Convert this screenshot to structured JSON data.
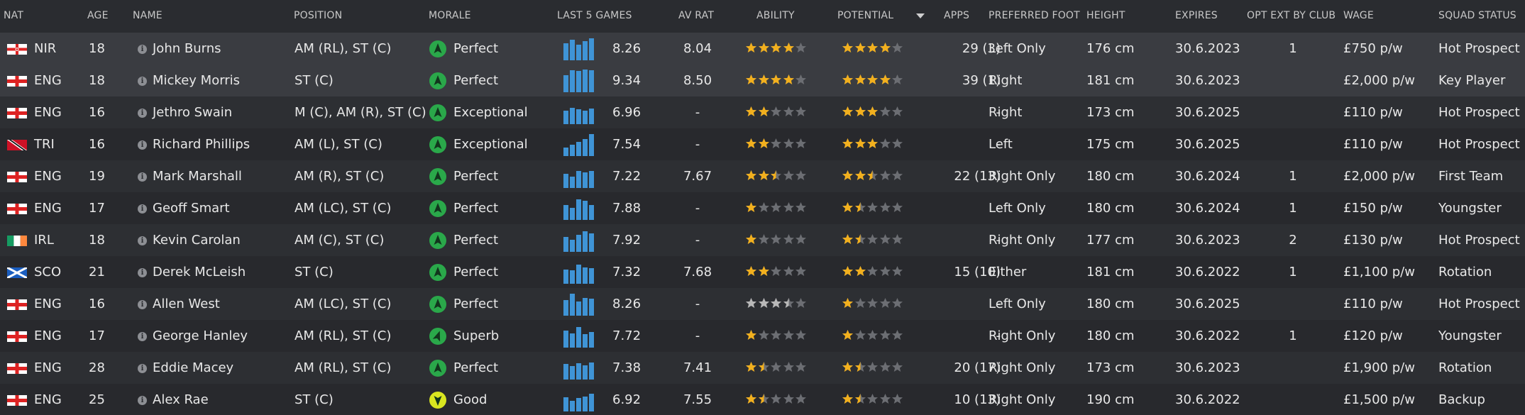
{
  "header": {
    "nat": "NAT",
    "age": "AGE",
    "name": "NAME",
    "position": "POSITION",
    "morale": "MORALE",
    "last5": "LAST 5 GAMES",
    "avrat": "AV RAT",
    "ability": "ABILITY",
    "potential": "POTENTIAL",
    "apps": "APPS",
    "foot": "PREFERRED FOOT",
    "height": "HEIGHT",
    "expires": "EXPIRES",
    "optext": "OPT EXT BY CLUB",
    "wage": "WAGE",
    "status": "SQUAD STATUS"
  },
  "colors": {
    "bar": "#3f94d6",
    "star_gold": "#f2b01e",
    "star_silver": "#b8b8b8",
    "star_empty": "#6c6e73",
    "morale_green": "#2aa84a",
    "morale_yellow": "#d9e620"
  },
  "rows": [
    {
      "nat": "NIR",
      "flag": "nir",
      "age": "18",
      "name": "John Burns",
      "position": "AM (RL), ST (C)",
      "morale": "Perfect",
      "morale_level": "perfect",
      "last5": [
        0.72,
        0.86,
        0.66,
        0.8,
        0.92
      ],
      "form": "8.26",
      "avrat": "8.04",
      "ability": 4.0,
      "ability_style": "gold",
      "potential": 4.0,
      "apps": "29 (3)",
      "foot": "Left Only",
      "height": "176 cm",
      "expires": "30.6.2023",
      "optext": "1",
      "wage": "£750 p/w",
      "status": "Hot Prospect"
    },
    {
      "nat": "ENG",
      "flag": "eng",
      "age": "18",
      "name": "Mickey Morris",
      "position": "ST (C)",
      "morale": "Perfect",
      "morale_level": "perfect",
      "last5": [
        0.72,
        0.92,
        0.88,
        0.95,
        0.9
      ],
      "form": "9.34",
      "avrat": "8.50",
      "ability": 4.0,
      "ability_style": "gold",
      "potential": 4.0,
      "apps": "39 (1)",
      "foot": "Right",
      "height": "181 cm",
      "expires": "30.6.2023",
      "optext": "",
      "wage": "£2,000 p/w",
      "status": "Key Player"
    },
    {
      "nat": "ENG",
      "flag": "eng",
      "age": "16",
      "name": "Jethro Swain",
      "position": "M (C), AM (R), ST (C)",
      "morale": "Exceptional",
      "morale_level": "exceptional",
      "last5": [
        0.55,
        0.68,
        0.62,
        0.55,
        0.64
      ],
      "form": "6.96",
      "avrat": "-",
      "ability": 2.0,
      "ability_style": "gold",
      "potential": 3.0,
      "apps": "-",
      "foot": "Right",
      "height": "173 cm",
      "expires": "30.6.2025",
      "optext": "",
      "wage": "£110 p/w",
      "status": "Hot Prospect"
    },
    {
      "nat": "TRI",
      "flag": "tri",
      "age": "16",
      "name": "Richard Phillips",
      "position": "AM (L), ST (C)",
      "morale": "Exceptional",
      "morale_level": "exceptional",
      "last5": [
        0.35,
        0.48,
        0.58,
        0.72,
        0.9
      ],
      "form": "7.54",
      "avrat": "-",
      "ability": 2.0,
      "ability_style": "gold",
      "potential": 3.0,
      "apps": "-",
      "foot": "Left",
      "height": "175 cm",
      "expires": "30.6.2025",
      "optext": "",
      "wage": "£110 p/w",
      "status": "Hot Prospect"
    },
    {
      "nat": "ENG",
      "flag": "eng",
      "age": "19",
      "name": "Mark Marshall",
      "position": "AM (R), ST (C)",
      "morale": "Perfect",
      "morale_level": "perfect",
      "last5": [
        0.6,
        0.48,
        0.72,
        0.64,
        0.72
      ],
      "form": "7.22",
      "avrat": "7.67",
      "ability": 2.5,
      "ability_style": "gold",
      "potential": 2.5,
      "apps": "22 (13)",
      "foot": "Right Only",
      "height": "180 cm",
      "expires": "30.6.2024",
      "optext": "1",
      "wage": "£2,000 p/w",
      "status": "First Team"
    },
    {
      "nat": "ENG",
      "flag": "eng",
      "age": "17",
      "name": "Geoff Smart",
      "position": "AM (LC), ST (C)",
      "morale": "Perfect",
      "morale_level": "perfect",
      "last5": [
        0.62,
        0.5,
        0.85,
        0.78,
        0.62
      ],
      "form": "7.88",
      "avrat": "-",
      "ability": 1.0,
      "ability_style": "gold",
      "potential": 1.5,
      "apps": "-",
      "foot": "Left Only",
      "height": "180 cm",
      "expires": "30.6.2024",
      "optext": "1",
      "wage": "£150 p/w",
      "status": "Youngster"
    },
    {
      "nat": "IRL",
      "flag": "irl",
      "age": "18",
      "name": "Kevin Carolan",
      "position": "AM (C), ST (C)",
      "morale": "Perfect",
      "morale_level": "perfect",
      "last5": [
        0.62,
        0.5,
        0.72,
        0.85,
        0.76
      ],
      "form": "7.92",
      "avrat": "-",
      "ability": 1.0,
      "ability_style": "gold",
      "potential": 1.5,
      "apps": "-",
      "foot": "Right Only",
      "height": "177 cm",
      "expires": "30.6.2023",
      "optext": "2",
      "wage": "£130 p/w",
      "status": "Hot Prospect"
    },
    {
      "nat": "SCO",
      "flag": "sco",
      "age": "21",
      "name": "Derek McLeish",
      "position": "ST (C)",
      "morale": "Perfect",
      "morale_level": "perfect",
      "last5": [
        0.6,
        0.55,
        0.8,
        0.68,
        0.64
      ],
      "form": "7.32",
      "avrat": "7.68",
      "ability": 2.0,
      "ability_style": "gold",
      "potential": 2.0,
      "apps": "15 (10)",
      "foot": "Either",
      "height": "181 cm",
      "expires": "30.6.2022",
      "optext": "1",
      "wage": "£1,100 p/w",
      "status": "Rotation"
    },
    {
      "nat": "ENG",
      "flag": "eng",
      "age": "16",
      "name": "Allen West",
      "position": "AM (LC), ST (C)",
      "morale": "Perfect",
      "morale_level": "perfect",
      "last5": [
        0.64,
        0.9,
        0.6,
        0.74,
        0.72
      ],
      "form": "8.26",
      "avrat": "-",
      "ability": 3.5,
      "ability_style": "silver",
      "potential": 1.0,
      "apps": "-",
      "foot": "Left Only",
      "height": "180 cm",
      "expires": "30.6.2025",
      "optext": "",
      "wage": "£110 p/w",
      "status": "Hot Prospect"
    },
    {
      "nat": "ENG",
      "flag": "eng",
      "age": "17",
      "name": "George Hanley",
      "position": "AM (RL), ST (C)",
      "morale": "Superb",
      "morale_level": "superb",
      "last5": [
        0.72,
        0.6,
        0.85,
        0.55,
        0.66
      ],
      "form": "7.72",
      "avrat": "-",
      "ability": 1.0,
      "ability_style": "gold",
      "potential": 1.0,
      "apps": "-",
      "foot": "Right Only",
      "height": "180 cm",
      "expires": "30.6.2022",
      "optext": "1",
      "wage": "£120 p/w",
      "status": "Youngster"
    },
    {
      "nat": "ENG",
      "flag": "eng",
      "age": "28",
      "name": "Eddie Macey",
      "position": "AM (RL), ST (C)",
      "morale": "Perfect",
      "morale_level": "perfect",
      "last5": [
        0.66,
        0.55,
        0.68,
        0.6,
        0.72
      ],
      "form": "7.38",
      "avrat": "7.41",
      "ability": 1.5,
      "ability_style": "gold",
      "potential": 1.5,
      "apps": "20 (17)",
      "foot": "Right Only",
      "height": "173 cm",
      "expires": "30.6.2023",
      "optext": "",
      "wage": "£1,900 p/w",
      "status": "Rotation"
    },
    {
      "nat": "ENG",
      "flag": "eng",
      "age": "25",
      "name": "Alex Rae",
      "position": "ST (C)",
      "morale": "Good",
      "morale_level": "good",
      "last5": [
        0.6,
        0.45,
        0.55,
        0.62,
        0.74
      ],
      "form": "6.92",
      "avrat": "7.55",
      "ability": 1.5,
      "ability_style": "gold",
      "potential": 1.5,
      "apps": "10 (13)",
      "foot": "Right Only",
      "height": "190 cm",
      "expires": "30.6.2022",
      "optext": "",
      "wage": "£1,500 p/w",
      "status": "Backup"
    }
  ]
}
